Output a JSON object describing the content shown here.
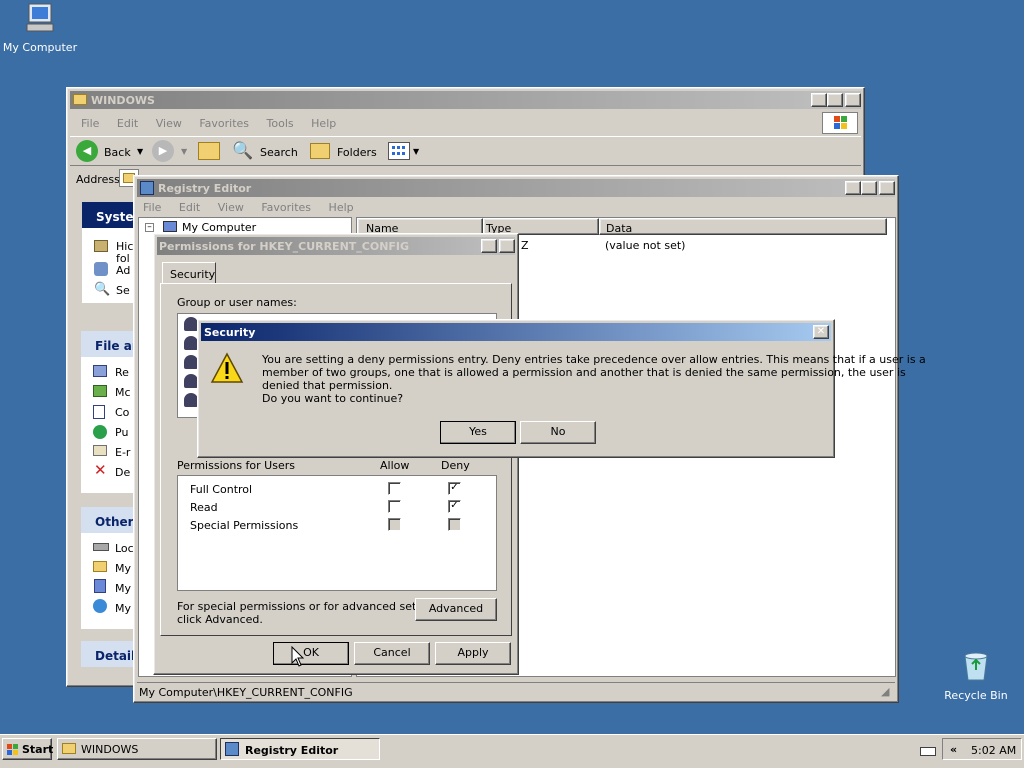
{
  "desktop": {
    "my_computer": "My Computer",
    "recycle_bin": "Recycle Bin"
  },
  "explorer": {
    "title": "WINDOWS",
    "menu": [
      "File",
      "Edit",
      "View",
      "Favorites",
      "Tools",
      "Help"
    ],
    "toolbar": {
      "back": "Back",
      "search": "Search",
      "folders": "Folders"
    },
    "address_label": "Address",
    "side": {
      "system_header": "System",
      "system_items": [
        "Hic",
        "fol",
        "Ad",
        "Se"
      ],
      "file_header": "File an",
      "file_items": [
        "Re",
        "Mc",
        "Co",
        "Pu",
        "E-r",
        "De"
      ],
      "other_header": "Other",
      "other_items": [
        "Loc",
        "My",
        "My",
        "My"
      ],
      "details_header": "Details"
    }
  },
  "regedit": {
    "title": "Registry Editor",
    "menu": [
      "File",
      "Edit",
      "View",
      "Favorites",
      "Help"
    ],
    "tree_root": "My Computer",
    "columns": [
      "Name",
      "Type",
      "Data"
    ],
    "row": {
      "type": "Z",
      "data": "(value not set)"
    },
    "status": "My Computer\\HKEY_CURRENT_CONFIG"
  },
  "permissions": {
    "title": "Permissions for HKEY_CURRENT_CONFIG",
    "help_btn": "?",
    "tab": "Security",
    "group_label": "Group or user names:",
    "perm_header": "Permissions for Users",
    "allow_col": "Allow",
    "deny_col": "Deny",
    "rows": [
      {
        "name": "Full Control",
        "allow": false,
        "deny": true,
        "disabled": false
      },
      {
        "name": "Read",
        "allow": false,
        "deny": true,
        "disabled": false
      },
      {
        "name": "Special Permissions",
        "allow": false,
        "deny": false,
        "disabled": true
      }
    ],
    "special_text_1": "For special permissions or for advanced settings,",
    "special_text_2": "click Advanced.",
    "advanced": "Advanced",
    "ok": "OK",
    "cancel": "Cancel",
    "apply": "Apply"
  },
  "security_dialog": {
    "title": "Security",
    "line1": "You are setting a deny permissions entry. Deny entries take precedence over allow entries. This means that if a user is a",
    "line2": "member of two groups, one that is allowed a permission and another that is denied the same permission, the user is",
    "line3": "denied that permission.",
    "line4": "Do you want to continue?",
    "yes": "Yes",
    "no": "No",
    "icon": "warning-icon"
  },
  "taskbar": {
    "start": "Start",
    "tasks": [
      "WINDOWS",
      "Registry Editor"
    ],
    "tray_toggle": "«",
    "clock": "5:02 AM"
  },
  "colors": {
    "desktop": "#3a6ea5",
    "title_active": "#0a246a",
    "title_inactive": "#808080",
    "face": "#d4d0c8"
  }
}
